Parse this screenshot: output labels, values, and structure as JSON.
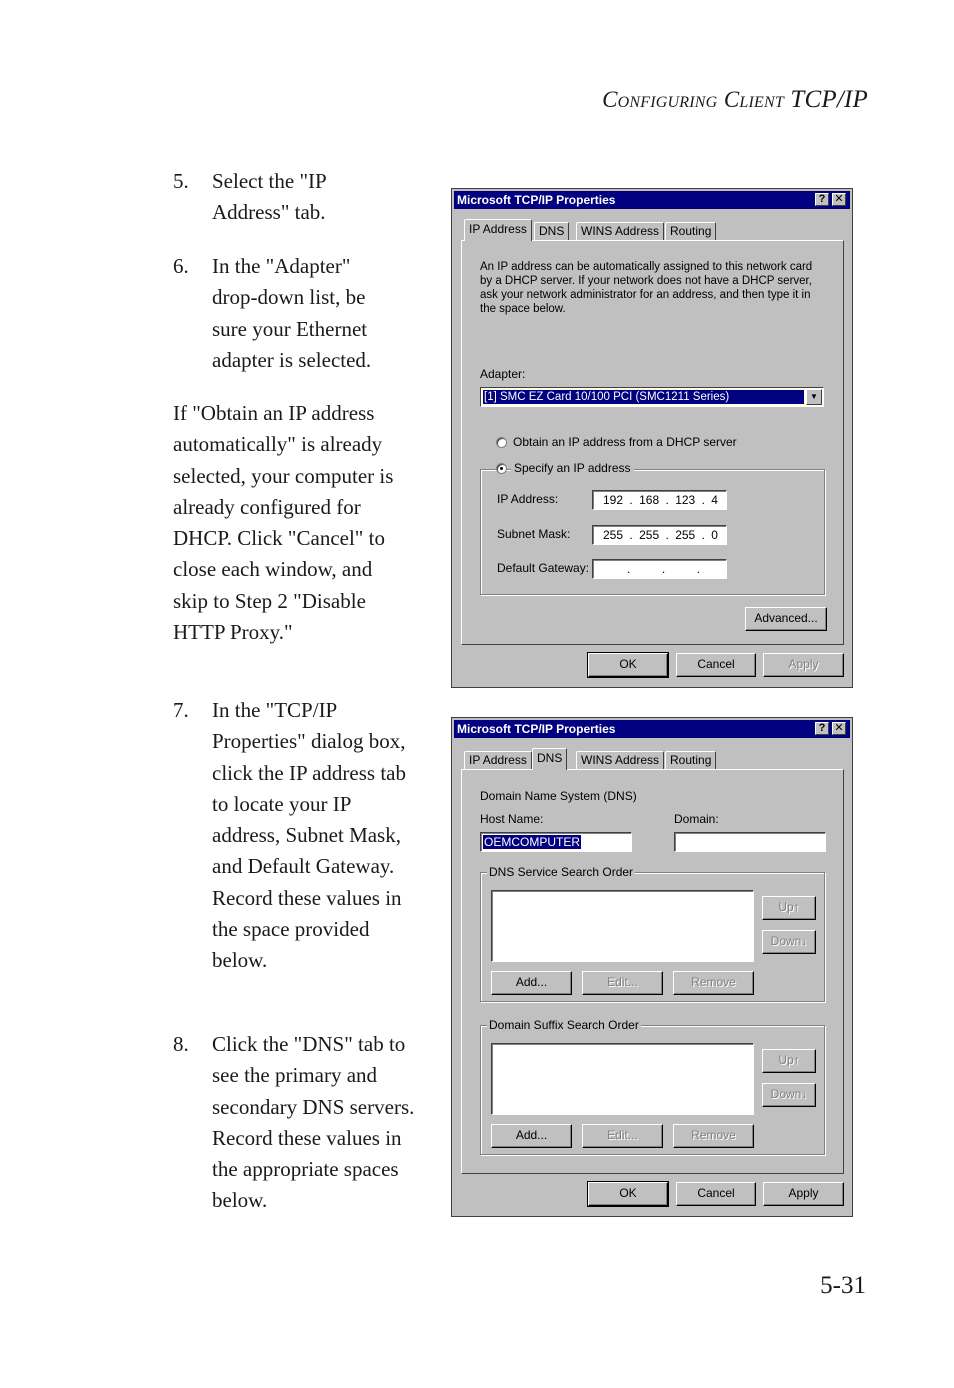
{
  "header": {
    "title_smallcaps_1": "Configuring",
    "title_smallcaps_2": "Client",
    "title_rest": "TCP/IP"
  },
  "page_number": "5-31",
  "steps": [
    {
      "number": "5.",
      "text": "Select the \"IP Address\" tab."
    },
    {
      "number": "6.",
      "text": "In the \"Adapter\" drop-down list, be sure your Ethernet adapter is selected."
    },
    {
      "number": "7.",
      "text": "In the \"TCP/IP Properties\" dialog box, click the IP address tab to locate your IP address, Subnet Mask, and Default Gateway. Record these values in the space provided below."
    },
    {
      "number": "8.",
      "text": "Click the \"DNS\" tab to see the primary and secondary DNS servers. Record these values in the appropriate spaces below."
    }
  ],
  "note_paragraph": "If \"Obtain an IP address automatically\" is already selected, your computer is already configured for DHCP. Click \"Cancel\" to close each window, and skip to Step 2 \"Disable HTTP Proxy.\"",
  "dialog_common": {
    "title": "Microsoft TCP/IP Properties",
    "help_glyph": "?",
    "close_glyph": "✕",
    "tabs": [
      "IP Address",
      "DNS",
      "WINS Address",
      "Routing"
    ],
    "ok_label": "OK",
    "cancel_label": "Cancel",
    "apply_label": "Apply"
  },
  "dialog_ip": {
    "active_tab": "IP Address",
    "description": "An IP address can be automatically assigned to this network card by a DHCP server.  If your network does not have a DHCP server, ask your network administrator for an address, and then type it in the space below.",
    "adapter_label": "Adapter:",
    "adapter_value": "[1] SMC EZ Card 10/100 PCI (SMC1211 Series)",
    "radio_obtain_label": "Obtain an IP address from a DHCP server",
    "radio_specify_label": "Specify an IP address",
    "selected_radio": "specify",
    "ip_address_label": "IP Address:",
    "ip_address": [
      "192",
      "168",
      "123",
      "4"
    ],
    "subnet_mask_label": "Subnet Mask:",
    "subnet_mask": [
      "255",
      "255",
      "255",
      "0"
    ],
    "gateway_label": "Default Gateway:",
    "gateway": [
      "",
      "",
      "",
      ""
    ],
    "advanced_label": "Advanced...",
    "apply_enabled": false
  },
  "dialog_dns": {
    "active_tab": "DNS",
    "section_label": "Domain Name System (DNS)",
    "host_name_label": "Host Name:",
    "host_name_value": "OEMCOMPUTER",
    "domain_label": "Domain:",
    "domain_value": "",
    "dns_group_label": "DNS Service Search Order",
    "suffix_group_label": "Domain Suffix Search Order",
    "up_label": "Up↑",
    "down_label": "Down↓",
    "add_label": "Add...",
    "edit_label": "Edit...",
    "remove_label": "Remove",
    "apply_enabled": true
  }
}
